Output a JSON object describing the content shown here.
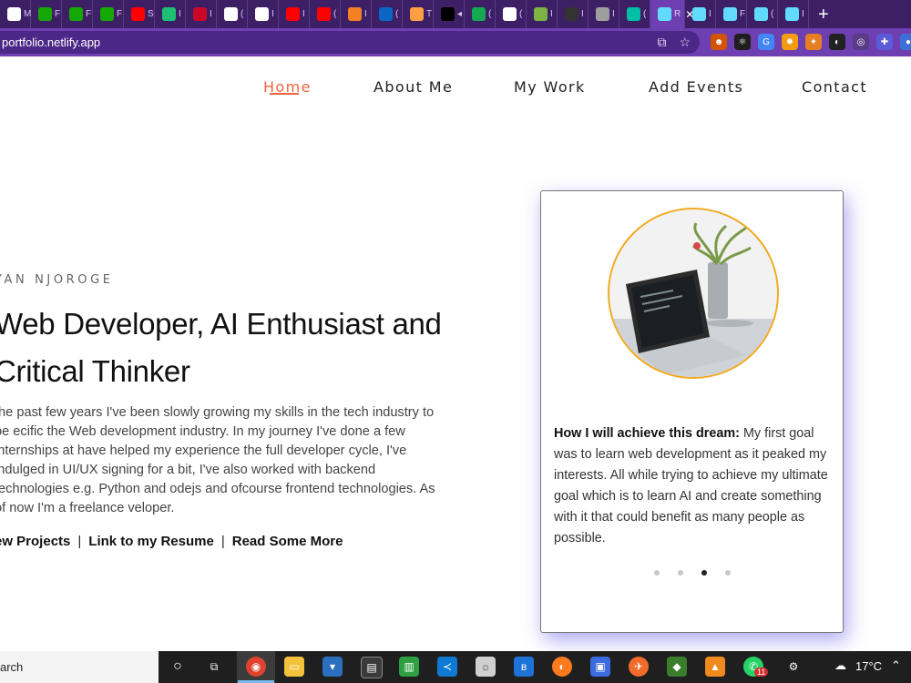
{
  "browser": {
    "tabs": [
      {
        "icon": "white-square-icon",
        "letter": "M",
        "color": "#ffffff"
      },
      {
        "icon": "upwork-icon",
        "letter": "F",
        "color": "#14a800"
      },
      {
        "icon": "upwork-icon",
        "letter": "F",
        "color": "#14a800"
      },
      {
        "icon": "upwork-icon",
        "letter": "F",
        "color": "#14a800"
      },
      {
        "icon": "youtube-icon",
        "letter": "S",
        "color": "#ff0000"
      },
      {
        "icon": "fiverr-icon",
        "letter": "I",
        "color": "#1dbf73"
      },
      {
        "icon": "basketball-icon",
        "letter": "I",
        "color": "#c9082a"
      },
      {
        "icon": "google-icon",
        "letter": "(",
        "color": "#ffffff"
      },
      {
        "icon": "notion-icon",
        "letter": "I",
        "color": "#ffffff"
      },
      {
        "icon": "youtube-icon",
        "letter": "I",
        "color": "#ff0000"
      },
      {
        "icon": "youtube-icon",
        "letter": "(",
        "color": "#ff0000"
      },
      {
        "icon": "stack-icon",
        "letter": "I",
        "color": "#f48024"
      },
      {
        "icon": "linkedin-icon",
        "letter": "(",
        "color": "#0a66c2"
      },
      {
        "icon": "cake-icon",
        "letter": "T",
        "color": "#ff9f43"
      },
      {
        "icon": "medium-icon",
        "letter": "◂",
        "color": "#000000"
      },
      {
        "icon": "leaf-icon",
        "letter": "(",
        "color": "#13aa52"
      },
      {
        "icon": "globe-icon",
        "letter": "(",
        "color": "#ffffff"
      },
      {
        "icon": "image-icon",
        "letter": "I",
        "color": "#7cb342"
      },
      {
        "icon": "github-icon",
        "letter": "I",
        "color": "#333333"
      },
      {
        "icon": "circle-icon",
        "letter": "I",
        "color": "#9e9e9e"
      },
      {
        "icon": "diamond-icon",
        "letter": "(",
        "color": "#00bfa5"
      },
      {
        "icon": "react-icon",
        "letter": "R",
        "color": "#61dafb",
        "active": true
      },
      {
        "icon": "react-icon",
        "letter": "I",
        "color": "#61dafb"
      },
      {
        "icon": "react-icon",
        "letter": "F",
        "color": "#61dafb"
      },
      {
        "icon": "react-icon",
        "letter": "(",
        "color": "#61dafb"
      },
      {
        "icon": "react-icon",
        "letter": "I",
        "color": "#61dafb"
      }
    ],
    "url": "portfolio.netlify.app",
    "new_tab": "+"
  },
  "nav": {
    "items": [
      "Home",
      "About Me",
      "My Work",
      "Add Events",
      "Contact"
    ],
    "active": "Home"
  },
  "hero": {
    "name": "YAN NJOROGE",
    "title_line1": "Web Developer, AI Enthusiast and",
    "title_line2": "Critical Thinker",
    "paragraph": "the past few years I've been slowly growing my skills in the tech industry to be ecific the Web development industry. In my journey I've done a few internships at have helped my experience the full developer cycle, I've indulged in UI/UX signing for a bit, I've also worked with backend technologies e.g. Python and odejs and ofcourse frontend technologies. As of now I'm a freelance veloper.",
    "links": [
      "ew Projects",
      "Link to my Resume",
      "Read Some More"
    ],
    "separator": "|"
  },
  "card": {
    "heading": "How I will achieve this dream:",
    "text": "My first goal was to learn web development as it peaked my interests. All while trying to achieve my ultimate goal which is to learn AI and create something with it that could benefit as many people as possible.",
    "dots": 4,
    "active_dot": 3
  },
  "taskbar": {
    "search": "arch",
    "temperature": "17°C",
    "notification_badge": "11"
  },
  "colors": {
    "accent": "#f0643c",
    "tabbar": "#3d1f66",
    "addressbar": "#6d3fb0",
    "avatar_border": "#f3a81d",
    "card_shadow": "#6e5fe6"
  }
}
